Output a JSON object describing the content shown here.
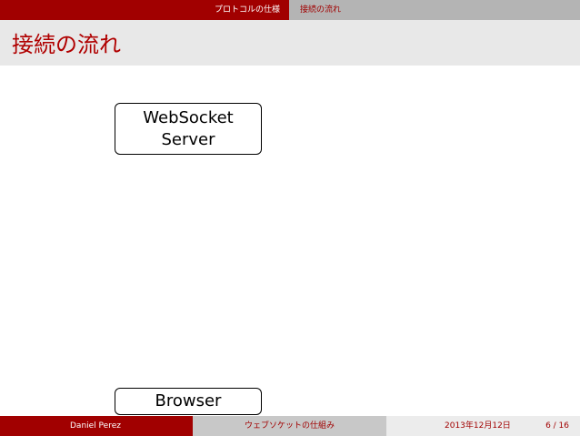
{
  "nav": {
    "section": "プロトコルの仕様",
    "subsection": "接続の流れ"
  },
  "slide": {
    "title": "接続の流れ"
  },
  "diagram": {
    "server_line1": "WebSocket",
    "server_line2": "Server",
    "browser": "Browser"
  },
  "footer": {
    "author": "Daniel Perez",
    "talk_title": "ウェブソケットの仕組み",
    "date": "2013年12月12日",
    "page": "6 / 16"
  },
  "colors": {
    "accent": "#a10000",
    "title_text": "#b00000",
    "nav_right_bg": "#b4b4b4",
    "title_bar_bg": "#e8e8e8"
  }
}
